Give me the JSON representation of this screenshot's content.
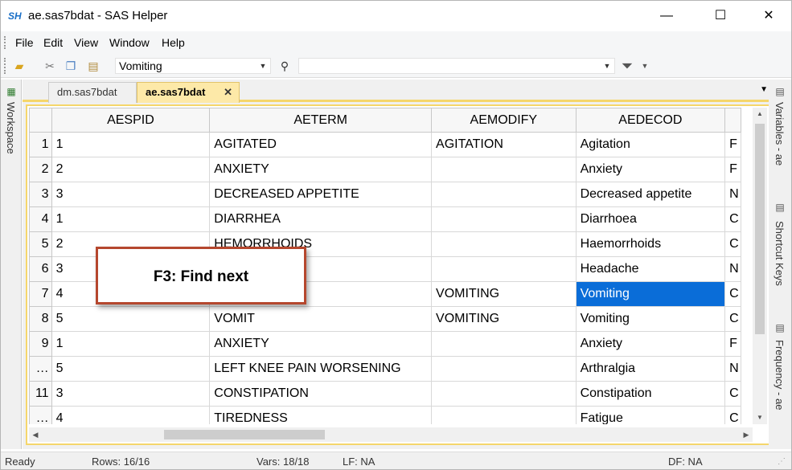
{
  "window": {
    "logo": "SH",
    "title": "ae.sas7bdat - SAS Helper",
    "minimize": "—",
    "maximize": "☐",
    "close": "✕"
  },
  "menu": [
    "File",
    "Edit",
    "View",
    "Window",
    "Help"
  ],
  "toolbar": {
    "search_value": "Vomiting",
    "filter_value": ""
  },
  "side_left": {
    "workspace": "Workspace"
  },
  "side_right": {
    "variables": "Variables - ae",
    "shortcut": "Shortcut Keys",
    "frequency": "Frequency - ae"
  },
  "tabs": {
    "dm": "dm.sas7bdat",
    "ae": "ae.sas7bdat",
    "close": "✕"
  },
  "table": {
    "columns": [
      "AESPID",
      "AETERM",
      "AEMODIFY",
      "AEDECOD"
    ],
    "rows": [
      {
        "rn": "1",
        "c": [
          "1",
          "AGITATED",
          "AGITATION",
          "Agitation",
          "F"
        ]
      },
      {
        "rn": "2",
        "c": [
          "2",
          "ANXIETY",
          "",
          "Anxiety",
          "F"
        ]
      },
      {
        "rn": "3",
        "c": [
          "3",
          "DECREASED APPETITE",
          "",
          "Decreased appetite",
          "N"
        ]
      },
      {
        "rn": "4",
        "c": [
          "1",
          "DIARRHEA",
          "",
          "Diarrhoea",
          "C"
        ]
      },
      {
        "rn": "5",
        "c": [
          "2",
          "HEMORRHOIDS",
          "",
          "Haemorrhoids",
          "C"
        ]
      },
      {
        "rn": "6",
        "c": [
          "3",
          "",
          "",
          "Headache",
          "N"
        ]
      },
      {
        "rn": "7",
        "c": [
          "4",
          "",
          "VOMITING",
          "Vomiting",
          "C"
        ]
      },
      {
        "rn": "8",
        "c": [
          "5",
          "VOMIT",
          "VOMITING",
          "Vomiting",
          "C"
        ]
      },
      {
        "rn": "9",
        "c": [
          "1",
          "ANXIETY",
          "",
          "Anxiety",
          "F"
        ]
      },
      {
        "rn": "…",
        "c": [
          "5",
          "LEFT KNEE PAIN WORSENING",
          "",
          "Arthralgia",
          "N"
        ]
      },
      {
        "rn": "11",
        "c": [
          "3",
          "CONSTIPATION",
          "",
          "Constipation",
          "C"
        ]
      },
      {
        "rn": "…",
        "c": [
          "4",
          "TIREDNESS",
          "",
          "Fatigue",
          "C"
        ]
      }
    ]
  },
  "callout": "F3: Find next",
  "status": {
    "ready": "Ready",
    "rows": "Rows: 16/16",
    "vars": "Vars: 18/18",
    "lf": "LF: NA",
    "df": "DF: NA"
  },
  "colors": {
    "selection": "#0a6dd8",
    "active_tab": "#fde9a8",
    "callout_border": "#b5472e"
  }
}
